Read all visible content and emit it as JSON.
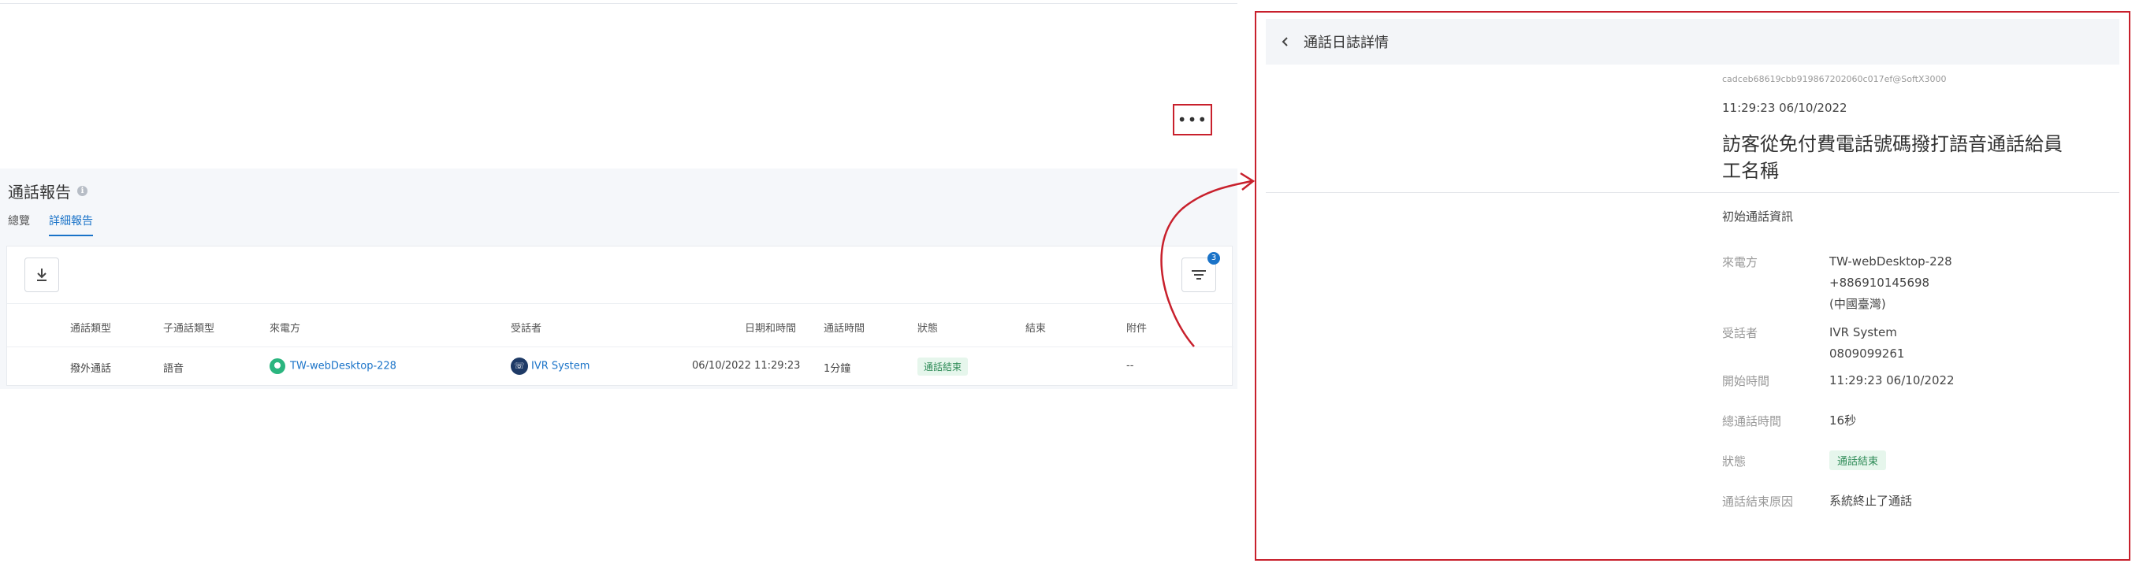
{
  "report": {
    "title": "通話報告",
    "tabs": [
      {
        "label": "總覽",
        "active": false
      },
      {
        "label": "詳細報告",
        "active": true
      }
    ],
    "filter_count": "3",
    "columns": [
      "通話類型",
      "子通話類型",
      "來電方",
      "受話者",
      "日期和時間",
      "通話時間",
      "狀態",
      "結束",
      "附件"
    ],
    "row": {
      "call_type": "撥外通話",
      "sub_type": "語音",
      "caller": "TW-webDesktop-228",
      "callee": "IVR System",
      "datetime": "06/10/2022  11:29:23",
      "duration": "1分鐘",
      "status": "通話結束",
      "ended": "",
      "attachment": "--",
      "more": "•••"
    }
  },
  "detail": {
    "title": "通話日誌詳情",
    "call_id": "cadceb68619cbb919867202060c017ef@SoftX3000",
    "time": "11:29:23 06/10/2022",
    "description": "訪客從免付費電話號碼撥打語音通話給員工名稱",
    "section_title": "初始通話資訊",
    "fields": {
      "caller_label": "來電方",
      "caller_name": "TW-webDesktop-228",
      "caller_number": "+886910145698",
      "caller_region": "(中國臺灣)",
      "callee_label": "受話者",
      "callee_name": "IVR System",
      "callee_number": "0809099261",
      "start_label": "開始時間",
      "start_value": "11:29:23 06/10/2022",
      "total_label": "總通話時間",
      "total_value": "16秒",
      "status_label": "狀態",
      "status_value": "通話結束",
      "end_reason_label": "通話結束原因",
      "end_reason_value": "系統終止了通話"
    }
  },
  "colors": {
    "accent": "#1a73c8",
    "highlight_border": "#c8202c",
    "status_bg": "#e6f6ec",
    "status_text": "#2e8b57"
  }
}
